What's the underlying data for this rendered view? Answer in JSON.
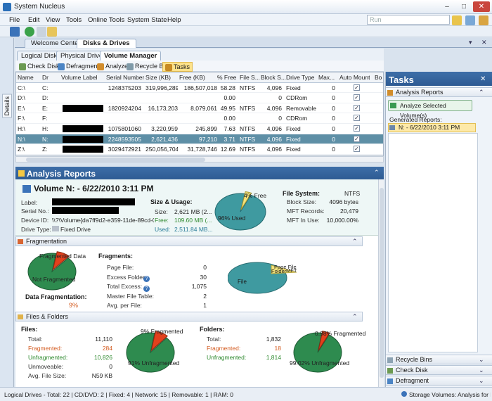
{
  "app": {
    "title": "System Nucleus"
  },
  "window_buttons": [
    "–",
    "□",
    "✕"
  ],
  "menu": [
    "File",
    "Edit",
    "View",
    "Tools",
    "Online Tools",
    "System State",
    "Help"
  ],
  "search": {
    "placeholder": "Run"
  },
  "side_panel": {
    "label": "Details"
  },
  "doc_tabs": [
    "Welcome Center",
    "Disks & Drives"
  ],
  "sub_tabs": [
    "Logical Disks",
    "Physical Drives",
    "Volume Manager"
  ],
  "actions": [
    "Check Disk",
    "Defragment",
    "Analyze",
    "Recycle Bin",
    "Tasks"
  ],
  "grid": {
    "columns": [
      "Name",
      "Dr",
      "Volume Label",
      "Serial Number",
      "Size (KB)",
      "Free (KB)",
      "% Free",
      "File S...",
      "Block S...",
      "Drive Type",
      "Max...",
      "Auto Mount",
      "Bo"
    ],
    "rows": [
      [
        "C:\\",
        "C:",
        "",
        "1248375203",
        "319,996,289",
        "186,507,018",
        "58.28",
        "NTFS",
        "4,096",
        "Fixed",
        "0"
      ],
      [
        "D:\\",
        "D:",
        "",
        "",
        "",
        "",
        "0.00",
        "",
        "0",
        "CDRom",
        "0"
      ],
      [
        "E:\\",
        "E:",
        "",
        "1820924204",
        "16,173,203",
        "8,079,061",
        "49.95",
        "NTFS",
        "4,096",
        "Removable",
        "0"
      ],
      [
        "F:\\",
        "F:",
        "",
        "",
        "",
        "",
        "0.00",
        "",
        "0",
        "CDRom",
        "0"
      ],
      [
        "H:\\",
        "H:",
        "",
        "1075801060",
        "3,220,959",
        "245,899",
        "7.63",
        "NTFS",
        "4,096",
        "Fixed",
        "0"
      ],
      [
        "N:\\",
        "N:",
        "",
        "2248593505",
        "2,621,436",
        "97,210",
        "3.71",
        "NTFS",
        "4,096",
        "Fixed",
        "0"
      ],
      [
        "Z:\\",
        "Z:",
        "",
        "3029472921",
        "250,056,704",
        "31,728,746",
        "12.69",
        "NTFS",
        "4,096",
        "Fixed",
        "0"
      ]
    ]
  },
  "analysis": {
    "header": "Analysis Reports",
    "volume_title": "Volume N: - 6/22/2010 3:11 PM",
    "labels": {
      "label": "Label:",
      "serial": "Serial No.:",
      "device": "Device ID:",
      "drive_type": "Drive Type:"
    },
    "device_id": "\\\\?\\Volume{da7ff9d2-e359-11de-89cd-0024",
    "drive_type": "Fixed Drive",
    "size_usage": {
      "title": "Size & Usage:",
      "size_label": "Size:",
      "size": "2,621 MB (2...",
      "free_label": "Free:",
      "free": "109.60 MB (...",
      "used_label": "Used:",
      "used": "2,511.84 MB..."
    },
    "usage_pie": {
      "free_label": "4% Free",
      "used_label": "96% Used",
      "free_pct": 4
    },
    "filesystem": {
      "title": "File System:",
      "fs": "NTFS",
      "rows": [
        [
          "Block Size:",
          "4096 bytes"
        ],
        [
          "MFT Records:",
          "20,479"
        ],
        [
          "MFT In Use:",
          "10,000.00%"
        ]
      ]
    },
    "fragmentation": {
      "header": "Fragmentation",
      "pie": {
        "frag_label": "Fragmented Data",
        "ok_label": "Not Fragmented",
        "frag_pct": 9
      },
      "data_frag_label": "Data Fragmentation:",
      "data_frag_value": "9%",
      "title": "Fragments:",
      "rows": [
        [
          "Page File:",
          "0"
        ],
        [
          "Excess Folder:",
          "30"
        ],
        [
          "Total Excess:",
          "1,075"
        ],
        [
          "Master File Table:",
          "2"
        ],
        [
          "Avg. per File:",
          "1"
        ]
      ],
      "pie2": {
        "labels": [
          "Page File",
          "Folder",
          "MFT",
          "File"
        ]
      }
    },
    "files_folders": {
      "header": "Files & Folders",
      "files_title": "Files:",
      "files_rows": [
        [
          "Total:",
          "11,110"
        ],
        [
          "Fragmented:",
          "284"
        ],
        [
          "Unfragmented:",
          "10,826"
        ],
        [
          "Unmoveable:",
          "0"
        ],
        [
          "Avg. File Size:",
          "N59 KB"
        ]
      ],
      "files_pie": {
        "frag_label": "9% Fragmented",
        "ok_label": "91% Unfragmented",
        "frag_pct": 9
      },
      "folders_title": "Folders:",
      "folders_rows": [
        [
          "Total:",
          "1,832"
        ],
        [
          "Fragmented:",
          "18"
        ],
        [
          "Unfragmented:",
          "1,814"
        ]
      ],
      "folders_pie": {
        "frag_label": "0.98% Fragmented",
        "ok_label": "99.02% Unfragmented",
        "frag_pct": 0.98
      }
    }
  },
  "tasks": {
    "title": "Tasks",
    "analysis_section": "Analysis Reports",
    "analyze_button": "Analyze Selected Volume(s)",
    "generated_label": "Generated Reports:",
    "report_item": "N: - 6/22/2010 3:11 PM",
    "sections": [
      "Recycle Bins",
      "Check Disk",
      "Defragment"
    ]
  },
  "status": {
    "left": "Logical Drives - Total: 22 | CD/DVD: 2 | Fixed: 4 | Network: 15 | Removable: 1 | RAM: 0",
    "right": "Storage Volumes: Analysis for N:"
  },
  "colors": {
    "accent": "#2e5b93",
    "pie_green": "#2e8b4f",
    "pie_teal": "#3f9aa0",
    "pie_red": "#e2401c",
    "pie_yellow": "#f3e27a"
  }
}
